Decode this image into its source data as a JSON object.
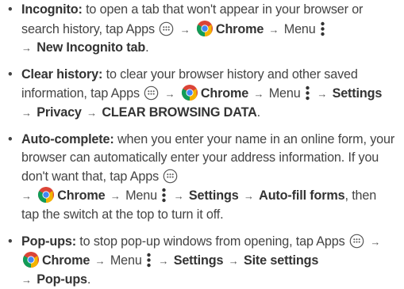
{
  "icons": {
    "apps": "apps-icon",
    "chrome": "chrome-icon",
    "menu": "menu-icon",
    "arrow": "→"
  },
  "colors": {
    "text": "#444444",
    "bold": "#333333",
    "chrome_red": "#db4437",
    "chrome_yellow": "#f4b400",
    "chrome_green": "#0f9d58",
    "chrome_blue": "#4285f4"
  },
  "items": [
    {
      "title": "Incognito:",
      "t1": " to open a tab that won't appear in your browser or search history, tap Apps",
      "chrome": "Chrome",
      "menu": "Menu",
      "s1": "New Incognito tab",
      "end": "."
    },
    {
      "title": "Clear history:",
      "t1": " to clear your browser history and other saved information, tap Apps",
      "chrome": "Chrome",
      "menu": "Menu",
      "s1": "Settings",
      "s2": "Privacy",
      "s3": "CLEAR BROWSING DATA",
      "end": "."
    },
    {
      "title": "Auto-complete:",
      "t1": " when you enter your name in an online form, your browser can automatically enter your address information. If you don't want that, tap Apps",
      "chrome": "Chrome",
      "menu": "Menu",
      "s1": "Settings",
      "s2": "Auto-fill forms",
      "end": ", then tap the switch at the top to turn it off."
    },
    {
      "title": "Pop-ups:",
      "t1": " to stop pop-up windows from opening, tap Apps",
      "chrome": "Chrome",
      "menu": "Menu",
      "s1": "Settings",
      "s2": "Site settings",
      "s3": "Pop-ups",
      "end": "."
    }
  ]
}
